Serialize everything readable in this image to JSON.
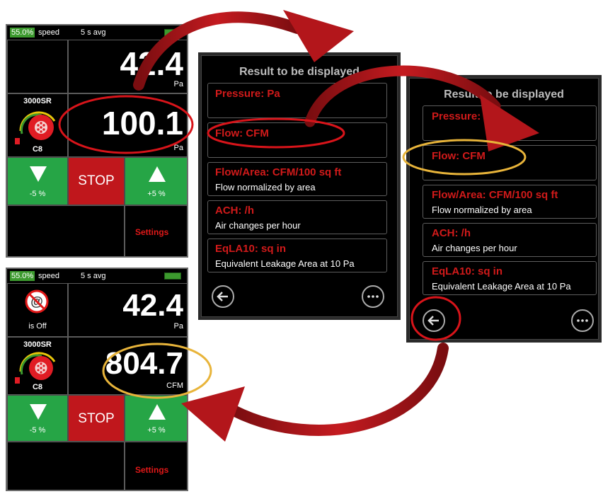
{
  "gauge_top": {
    "speed_percent": "55.0%",
    "speed_label": "speed",
    "avg_label": "5 s avg",
    "reading1_value": "42.4",
    "reading1_unit": "Pa",
    "reading2_value": "100.1",
    "reading2_unit": "Pa",
    "fan_model": "3000SR",
    "fan_ring": "C8",
    "down_label": "-5 %",
    "stop_label": "STOP",
    "up_label": "+5 %",
    "settings_label": "Settings"
  },
  "gauge_bottom": {
    "speed_percent": "55.0%",
    "speed_label": "speed",
    "avg_label": "5 s avg",
    "status_label": "is Off",
    "reading1_value": "42.4",
    "reading1_unit": "Pa",
    "reading2_value": "804.7",
    "reading2_unit": "CFM",
    "fan_model": "3000SR",
    "fan_ring": "C8",
    "down_label": "-5 %",
    "stop_label": "STOP",
    "up_label": "+5 %",
    "settings_label": "Settings"
  },
  "results_panel": {
    "title": "Result to be displayed",
    "items": [
      {
        "title": "Pressure: Pa",
        "desc": ""
      },
      {
        "title": "Flow: CFM",
        "desc": ""
      },
      {
        "title": "Flow/Area: CFM/100 sq ft",
        "desc": "Flow normalized by area"
      },
      {
        "title": "ACH: /h",
        "desc": "Air changes per hour"
      },
      {
        "title": "EqLA10: sq in",
        "desc": "Equivalent Leakage Area at 10 Pa"
      }
    ]
  },
  "icons": {
    "back": "back-arrow-icon",
    "more": "more-icon",
    "fan": "fan-icon",
    "no_wifi": "no-connection-icon",
    "down": "down-arrow-icon",
    "up": "up-arrow-icon"
  },
  "colors": {
    "green": "#26a546",
    "stop_red": "#c0171c",
    "text_red": "#d11a1a",
    "highlight_red": "#d8141a",
    "highlight_yellow": "#e8b43a",
    "arrow_red": "#a3161a"
  }
}
